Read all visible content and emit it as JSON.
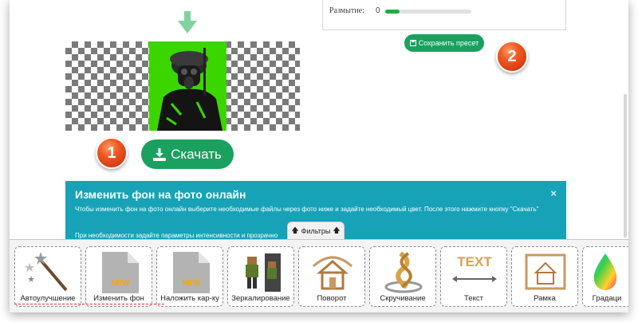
{
  "top_panel": {
    "label": "Размытие:",
    "value": "0",
    "slider_fraction": 0.17
  },
  "save_preset": {
    "label": "Сохранить пресет",
    "icon": "save-icon"
  },
  "badges": {
    "one": "1",
    "two": "2"
  },
  "download": {
    "label": "Скачать",
    "icon": "download-icon"
  },
  "info": {
    "title": "Изменить фон на фото онлайн",
    "close": "×",
    "text": "Чтобы изменить фон на фото онлайн выберите необходимые файлы через фото ниже и задайте необходимый цвет. После этого нажмите кнопку \"Скачать\"",
    "text2": "При необходимости задайте параметры интенсивности и прозрачно"
  },
  "filters_tab": {
    "label": "Фильтры",
    "icon": "arrow-up-icon"
  },
  "tools": [
    {
      "label": "Автоулучшение",
      "icon": "magic-wand-icon"
    },
    {
      "label": "Изменить фон",
      "icon": "new-file-icon"
    },
    {
      "label": "Наложить кар-ку",
      "icon": "new-file-icon"
    },
    {
      "label": "Зеркалирование",
      "icon": "mirror-icon"
    },
    {
      "label": "Поворот",
      "icon": "rotate-house-icon"
    },
    {
      "label": "Скручивание",
      "icon": "twist-icon"
    },
    {
      "label": "Текст",
      "icon": "text-icon"
    },
    {
      "label": "Рамка",
      "icon": "frame-icon"
    },
    {
      "label": "Градаци",
      "icon": "gradient-drop-icon"
    }
  ],
  "colors": {
    "accent_green": "#1aa05f",
    "info_teal": "#17a2b8",
    "badge_orange": "#f05a22",
    "photo_green": "#3bd600"
  }
}
